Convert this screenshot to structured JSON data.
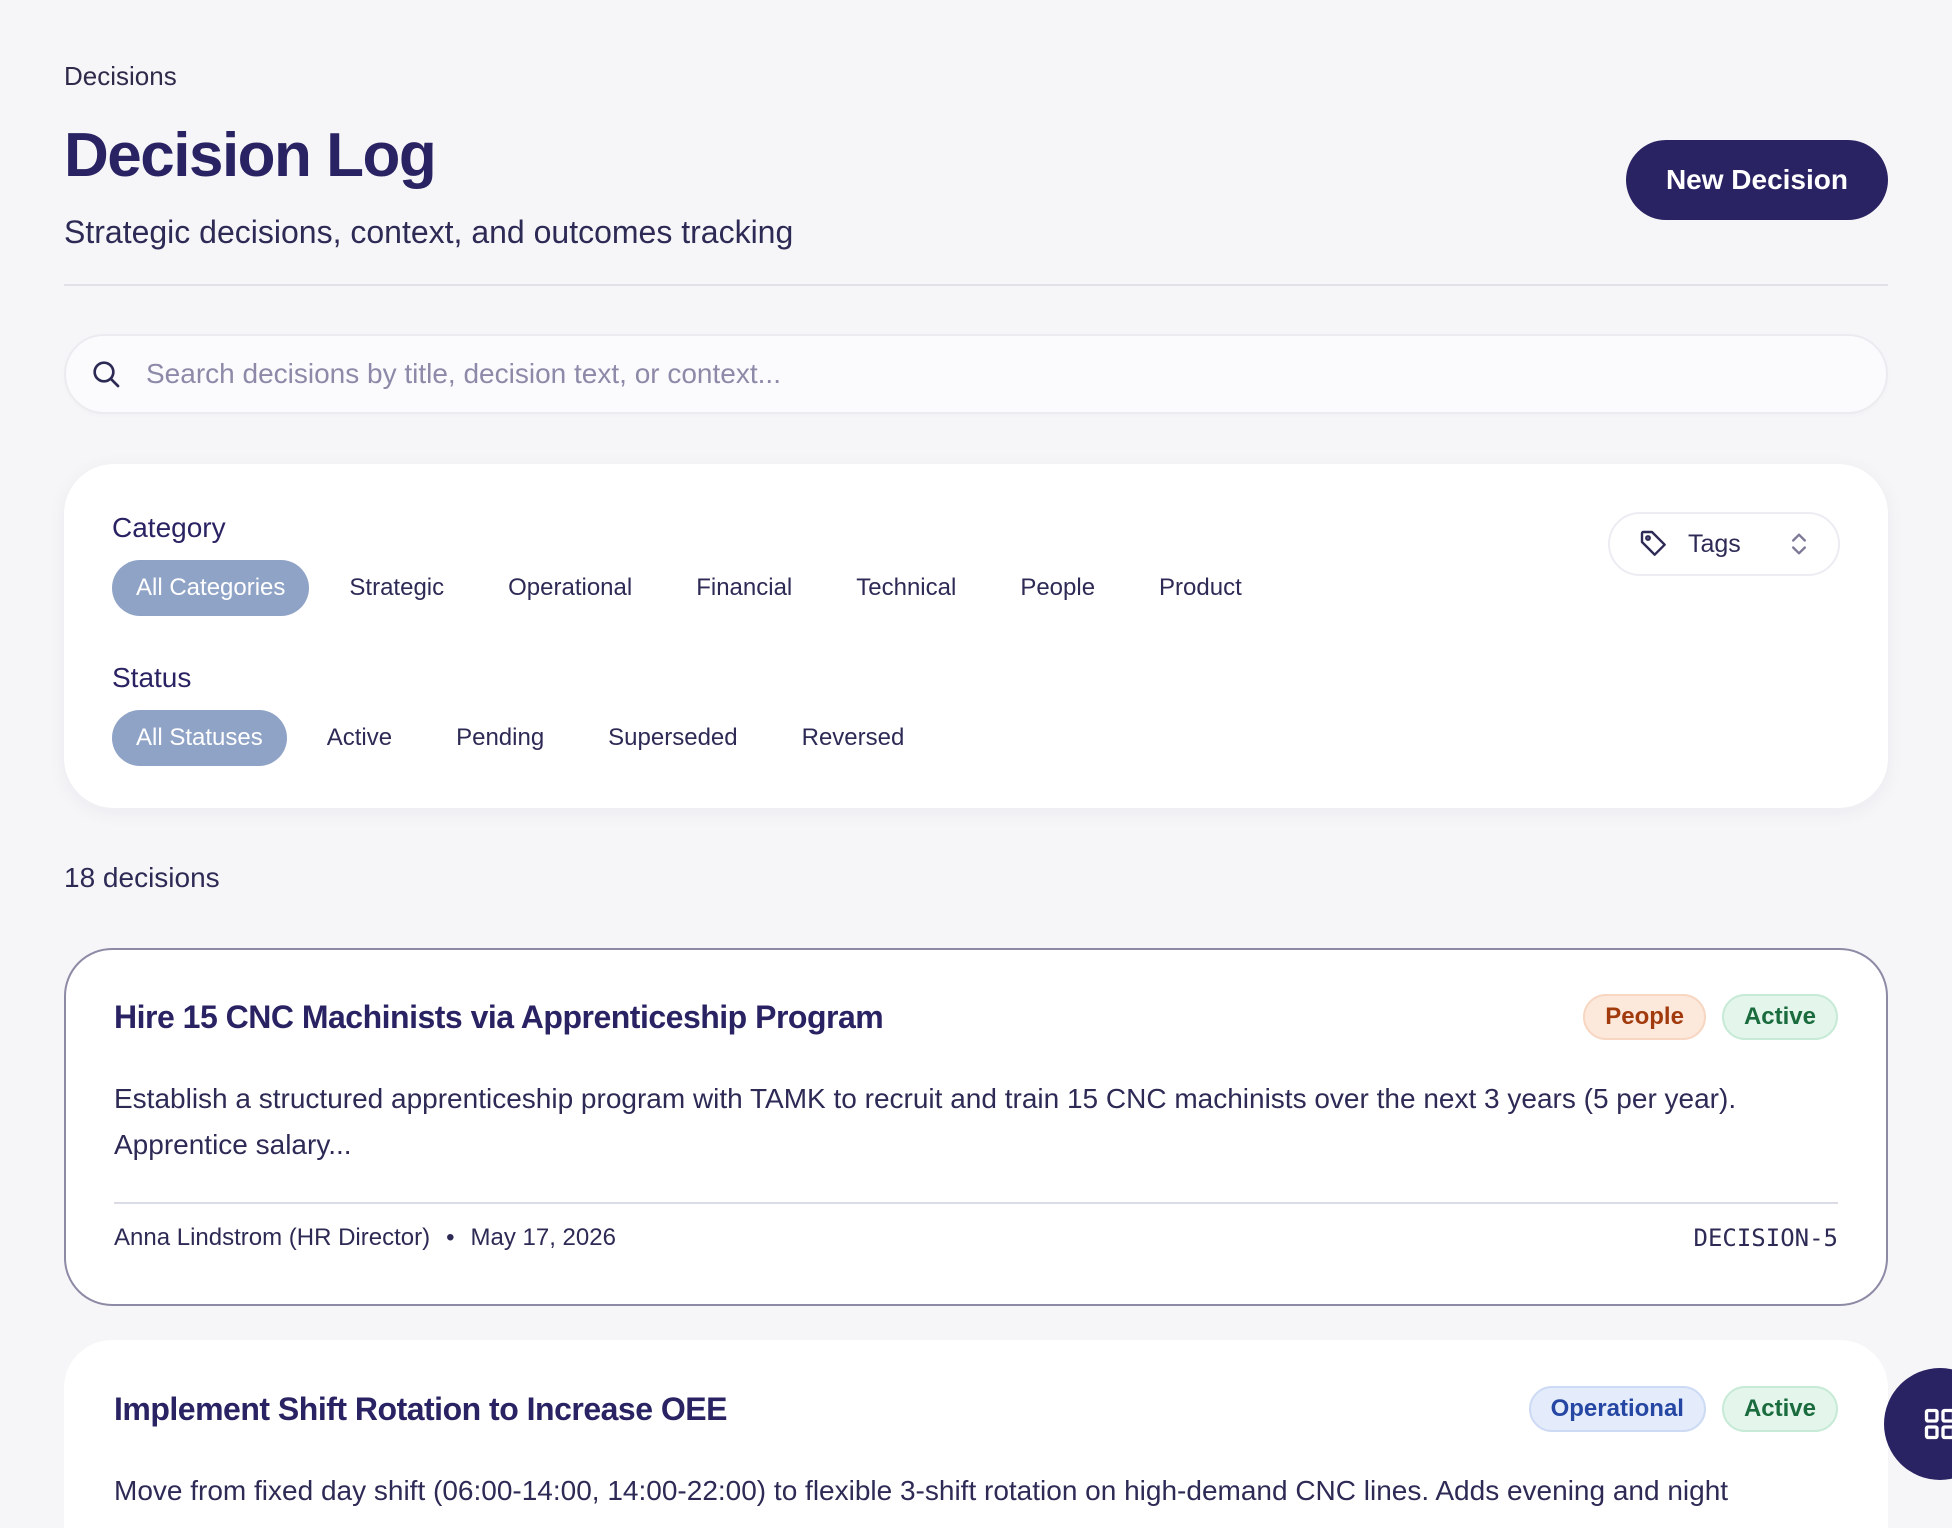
{
  "breadcrumb": "Decisions",
  "header": {
    "title": "Decision Log",
    "subtitle": "Strategic decisions, context, and outcomes tracking",
    "new_button": "New Decision"
  },
  "search": {
    "placeholder": "Search decisions by title, decision text, or context..."
  },
  "filters": {
    "category_label": "Category",
    "categories": [
      "All Categories",
      "Strategic",
      "Operational",
      "Financial",
      "Technical",
      "People",
      "Product"
    ],
    "selected_category": "All Categories",
    "status_label": "Status",
    "statuses": [
      "All Statuses",
      "Active",
      "Pending",
      "Superseded",
      "Reversed"
    ],
    "selected_status": "All Statuses",
    "tags_label": "Tags"
  },
  "count_text": "18 decisions",
  "decisions": [
    {
      "title": "Hire 15 CNC Machinists via Apprenticeship Program",
      "category": "People",
      "status": "Active",
      "description": "Establish a structured apprenticeship program with TAMK to recruit and train 15 CNC machinists over the next 3 years (5 per year). Apprentice salary...",
      "owner": "Anna Lindstrom (HR Director)",
      "date": "May 17, 2026",
      "id": "DECISION-5"
    },
    {
      "title": "Implement Shift Rotation to Increase OEE",
      "category": "Operational",
      "status": "Active",
      "description": "Move from fixed day shift (06:00-14:00, 14:00-22:00) to flexible 3-shift rotation on high-demand CNC lines. Adds evening and night"
    }
  ],
  "colors": {
    "primary": "#2a2363",
    "chip_selected": "#8fa3c6",
    "people_badge": "#fde9dc",
    "active_badge": "#e4f6ec",
    "operational_badge": "#e4ecfb"
  }
}
